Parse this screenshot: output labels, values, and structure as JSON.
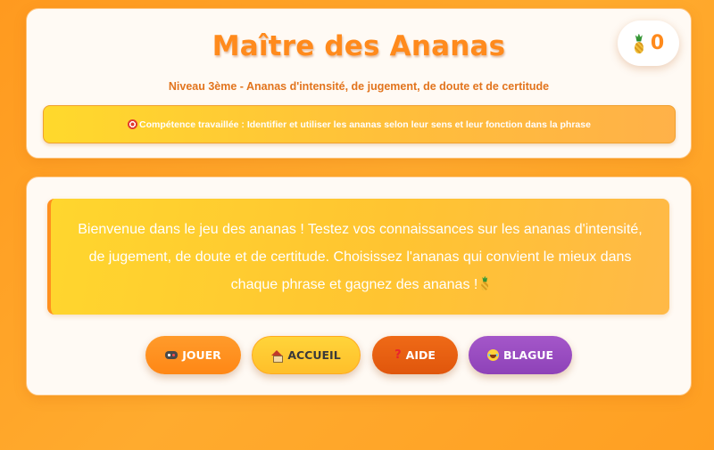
{
  "header": {
    "title": "Maître des Ananas",
    "subtitle": "Niveau 3ème - Ananas d'intensité, de jugement, de doute et de certitude",
    "skill_label": "Compétence travaillée : Identifier et utiliser les ananas selon leur sens et leur fonction dans la phrase",
    "skill_icon": "target-icon"
  },
  "score": {
    "icon": "pineapple-icon",
    "value": "0"
  },
  "main": {
    "welcome_text": "Bienvenue dans le jeu des ananas ! Testez vos connaissances sur les ananas d'intensité, de jugement, de doute et de certitude. Choisissez l'ananas qui convient le mieux dans chaque phrase et gagnez des ananas !",
    "welcome_icon": "pineapple-icon"
  },
  "buttons": {
    "play": {
      "label": "JOUER",
      "icon": "gamepad-icon"
    },
    "home": {
      "label": "ACCUEIL",
      "icon": "house-icon"
    },
    "help": {
      "label": "AIDE",
      "icon": "question-icon"
    },
    "joke": {
      "label": "BLAGUE",
      "icon": "laughing-face-icon"
    }
  },
  "colors": {
    "background": "#ff9a1f",
    "accent": "#ff8a1c",
    "help_button": "#e0560c",
    "joke_button": "#8e42b8",
    "home_button": "#ffc431"
  }
}
